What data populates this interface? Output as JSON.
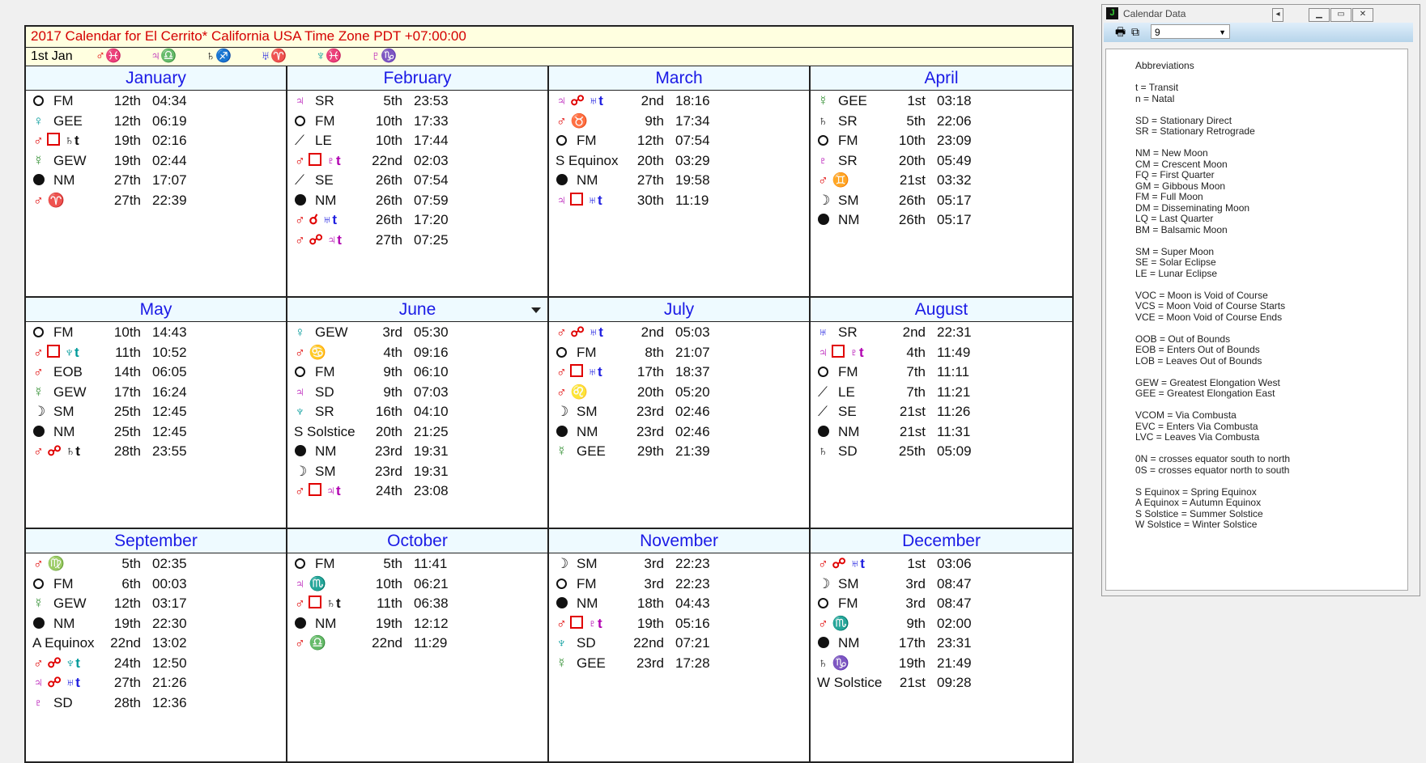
{
  "calendar": {
    "title": "2017 Calendar for El Cerrito* California USA Time Zone PDT +07:00:00",
    "start_label": "1st Jan",
    "positions": [
      {
        "planet": "♂",
        "planet_color": "red",
        "sign": "♓",
        "sign_color": "red"
      },
      {
        "planet": "♃",
        "planet_color": "pur",
        "sign": "♎",
        "sign_color": "blu"
      },
      {
        "planet": "♄",
        "planet_color": "blk",
        "sign": "♐",
        "sign_color": "red"
      },
      {
        "planet": "♅",
        "planet_color": "blu",
        "sign": "♈",
        "sign_color": "red"
      },
      {
        "planet": "♆",
        "planet_color": "tea",
        "sign": "♓",
        "sign_color": "red"
      },
      {
        "planet": "♇",
        "planet_color": "pur",
        "sign": "♑",
        "sign_color": "grn"
      }
    ],
    "months": [
      {
        "name": "January",
        "events": [
          {
            "icon": "fm",
            "label": "FM",
            "day": "12th",
            "time": "04:34"
          },
          {
            "icon": "venus",
            "label": "GEE",
            "day": "12th",
            "time": "06:19"
          },
          {
            "icon": "mars-sq-saturn",
            "day": "19th",
            "time": "02:16"
          },
          {
            "icon": "mercury",
            "label": "GEW",
            "day": "19th",
            "time": "02:44"
          },
          {
            "icon": "nm",
            "label": "NM",
            "day": "27th",
            "time": "17:07"
          },
          {
            "icon": "mars-aries",
            "day": "27th",
            "time": "22:39"
          }
        ]
      },
      {
        "name": "February",
        "events": [
          {
            "icon": "jupiter",
            "label": "SR",
            "day": "5th",
            "time": "23:53"
          },
          {
            "icon": "fm",
            "label": "FM",
            "day": "10th",
            "time": "17:33"
          },
          {
            "icon": "eclipse",
            "label": "LE",
            "day": "10th",
            "time": "17:44"
          },
          {
            "icon": "mars-sq-pluto",
            "day": "22nd",
            "time": "02:03"
          },
          {
            "icon": "eclipse",
            "label": "SE",
            "day": "26th",
            "time": "07:54"
          },
          {
            "icon": "nm",
            "label": "NM",
            "day": "26th",
            "time": "07:59"
          },
          {
            "icon": "mars-conj-uranus",
            "day": "26th",
            "time": "17:20"
          },
          {
            "icon": "mars-opp-jupiter",
            "day": "27th",
            "time": "07:25"
          }
        ]
      },
      {
        "name": "March",
        "events": [
          {
            "icon": "jupiter-opp-uranus",
            "day": "2nd",
            "time": "18:16"
          },
          {
            "icon": "mars-taurus",
            "day": "9th",
            "time": "17:34"
          },
          {
            "icon": "fm",
            "label": "FM",
            "day": "12th",
            "time": "07:54"
          },
          {
            "icon": "text",
            "label": "S Equinox",
            "day": "20th",
            "time": "03:29"
          },
          {
            "icon": "nm",
            "label": "NM",
            "day": "27th",
            "time": "19:58"
          },
          {
            "icon": "jupiter-sq-uranus",
            "day": "30th",
            "time": "11:19"
          }
        ]
      },
      {
        "name": "April",
        "events": [
          {
            "icon": "mercury",
            "label": "GEE",
            "day": "1st",
            "time": "03:18"
          },
          {
            "icon": "saturn",
            "label": "SR",
            "day": "5th",
            "time": "22:06"
          },
          {
            "icon": "fm",
            "label": "FM",
            "day": "10th",
            "time": "23:09"
          },
          {
            "icon": "pluto",
            "label": "SR",
            "day": "20th",
            "time": "05:49"
          },
          {
            "icon": "mars-gemini",
            "day": "21st",
            "time": "03:32"
          },
          {
            "icon": "moon",
            "label": "SM",
            "day": "26th",
            "time": "05:17"
          },
          {
            "icon": "nm",
            "label": "NM",
            "day": "26th",
            "time": "05:17"
          }
        ]
      },
      {
        "name": "May",
        "events": [
          {
            "icon": "fm",
            "label": "FM",
            "day": "10th",
            "time": "14:43"
          },
          {
            "icon": "mars-sq-neptune",
            "day": "11th",
            "time": "10:52"
          },
          {
            "icon": "mars",
            "label": "EOB",
            "day": "14th",
            "time": "06:05"
          },
          {
            "icon": "mercury",
            "label": "GEW",
            "day": "17th",
            "time": "16:24"
          },
          {
            "icon": "moon",
            "label": "SM",
            "day": "25th",
            "time": "12:45"
          },
          {
            "icon": "nm",
            "label": "NM",
            "day": "25th",
            "time": "12:45"
          },
          {
            "icon": "mars-opp-saturn",
            "day": "28th",
            "time": "23:55"
          }
        ]
      },
      {
        "name": "June",
        "dropdown": true,
        "events": [
          {
            "icon": "venus",
            "label": "GEW",
            "day": "3rd",
            "time": "05:30"
          },
          {
            "icon": "mars-cancer",
            "day": "4th",
            "time": "09:16"
          },
          {
            "icon": "fm",
            "label": "FM",
            "day": "9th",
            "time": "06:10"
          },
          {
            "icon": "jupiter",
            "label": "SD",
            "day": "9th",
            "time": "07:03"
          },
          {
            "icon": "neptune",
            "label": "SR",
            "day": "16th",
            "time": "04:10"
          },
          {
            "icon": "text",
            "label": "S Solstice",
            "day": "20th",
            "time": "21:25"
          },
          {
            "icon": "nm",
            "label": "NM",
            "day": "23rd",
            "time": "19:31"
          },
          {
            "icon": "moon",
            "label": "SM",
            "day": "23rd",
            "time": "19:31"
          },
          {
            "icon": "mars-sq-jupiter",
            "day": "24th",
            "time": "23:08"
          }
        ]
      },
      {
        "name": "July",
        "events": [
          {
            "icon": "mars-opp-uranus",
            "day": "2nd",
            "time": "05:03"
          },
          {
            "icon": "fm",
            "label": "FM",
            "day": "8th",
            "time": "21:07"
          },
          {
            "icon": "mars-sq-uranus",
            "day": "17th",
            "time": "18:37"
          },
          {
            "icon": "mars-leo",
            "day": "20th",
            "time": "05:20"
          },
          {
            "icon": "moon",
            "label": "SM",
            "day": "23rd",
            "time": "02:46"
          },
          {
            "icon": "nm",
            "label": "NM",
            "day": "23rd",
            "time": "02:46"
          },
          {
            "icon": "mercury",
            "label": "GEE",
            "day": "29th",
            "time": "21:39"
          }
        ]
      },
      {
        "name": "August",
        "events": [
          {
            "icon": "uranus",
            "label": "SR",
            "day": "2nd",
            "time": "22:31"
          },
          {
            "icon": "jupiter-sq-pluto",
            "day": "4th",
            "time": "11:49"
          },
          {
            "icon": "fm",
            "label": "FM",
            "day": "7th",
            "time": "11:11"
          },
          {
            "icon": "eclipse",
            "label": "LE",
            "day": "7th",
            "time": "11:21"
          },
          {
            "icon": "eclipse",
            "label": "SE",
            "day": "21st",
            "time": "11:26"
          },
          {
            "icon": "nm",
            "label": "NM",
            "day": "21st",
            "time": "11:31"
          },
          {
            "icon": "saturn",
            "label": "SD",
            "day": "25th",
            "time": "05:09"
          }
        ]
      },
      {
        "name": "September",
        "events": [
          {
            "icon": "mars-virgo",
            "day": "5th",
            "time": "02:35"
          },
          {
            "icon": "fm",
            "label": "FM",
            "day": "6th",
            "time": "00:03"
          },
          {
            "icon": "mercury",
            "label": "GEW",
            "day": "12th",
            "time": "03:17"
          },
          {
            "icon": "nm",
            "label": "NM",
            "day": "19th",
            "time": "22:30"
          },
          {
            "icon": "text",
            "label": "A Equinox",
            "day": "22nd",
            "time": "13:02"
          },
          {
            "icon": "mars-opp-neptune",
            "day": "24th",
            "time": "12:50"
          },
          {
            "icon": "jupiter-opp-uranus",
            "day": "27th",
            "time": "21:26"
          },
          {
            "icon": "pluto",
            "label": "SD",
            "day": "28th",
            "time": "12:36"
          }
        ]
      },
      {
        "name": "October",
        "events": [
          {
            "icon": "fm",
            "label": "FM",
            "day": "5th",
            "time": "11:41"
          },
          {
            "icon": "jupiter-scorpio",
            "day": "10th",
            "time": "06:21"
          },
          {
            "icon": "mars-sq-saturn",
            "day": "11th",
            "time": "06:38"
          },
          {
            "icon": "nm",
            "label": "NM",
            "day": "19th",
            "time": "12:12"
          },
          {
            "icon": "mars-libra",
            "day": "22nd",
            "time": "11:29"
          }
        ]
      },
      {
        "name": "November",
        "events": [
          {
            "icon": "moon",
            "label": "SM",
            "day": "3rd",
            "time": "22:23"
          },
          {
            "icon": "fm",
            "label": "FM",
            "day": "3rd",
            "time": "22:23"
          },
          {
            "icon": "nm",
            "label": "NM",
            "day": "18th",
            "time": "04:43"
          },
          {
            "icon": "mars-sq-pluto",
            "day": "19th",
            "time": "05:16"
          },
          {
            "icon": "neptune",
            "label": "SD",
            "day": "22nd",
            "time": "07:21"
          },
          {
            "icon": "mercury",
            "label": "GEE",
            "day": "23rd",
            "time": "17:28"
          }
        ]
      },
      {
        "name": "December",
        "events": [
          {
            "icon": "mars-opp-uranus",
            "day": "1st",
            "time": "03:06"
          },
          {
            "icon": "moon",
            "label": "SM",
            "day": "3rd",
            "time": "08:47"
          },
          {
            "icon": "fm",
            "label": "FM",
            "day": "3rd",
            "time": "08:47"
          },
          {
            "icon": "mars-scorpio",
            "day": "9th",
            "time": "02:00"
          },
          {
            "icon": "nm",
            "label": "NM",
            "day": "17th",
            "time": "23:31"
          },
          {
            "icon": "saturn-capricorn",
            "day": "19th",
            "time": "21:49"
          },
          {
            "icon": "text",
            "label": "W Solstice",
            "day": "21st",
            "time": "09:28"
          }
        ]
      }
    ]
  },
  "side_window": {
    "title": "Calendar Data",
    "app_icon": "J",
    "combo_value": "9",
    "lines": [
      "Abbreviations",
      "",
      "t = Transit",
      "n = Natal",
      "",
      "SD = Stationary Direct",
      "SR = Stationary Retrograde",
      "",
      "NM = New Moon",
      "CM = Crescent Moon",
      "FQ = First Quarter",
      "GM = Gibbous Moon",
      "FM = Full Moon",
      "DM = Disseminating Moon",
      "LQ = Last Quarter",
      "BM = Balsamic Moon",
      "",
      "SM = Super Moon",
      "SE = Solar Eclipse",
      "LE = Lunar Eclipse",
      "",
      "VOC = Moon is Void of Course",
      "VCS = Moon Void of Course Starts",
      "VCE = Moon Void of Course Ends",
      "",
      "OOB = Out of Bounds",
      "EOB = Enters Out of Bounds",
      "LOB = Leaves Out of Bounds",
      "",
      "GEW = Greatest Elongation West",
      "GEE = Greatest Elongation East",
      "",
      "VCOM = Via Combusta",
      "EVC = Enters Via Combusta",
      "LVC = Leaves Via Combusta",
      "",
      "0N = crosses equator south to north",
      "0S = crosses equator north to south",
      "",
      "S Equinox = Spring Equinox",
      "A Equinox = Autumn Equinox",
      "S Solstice = Summer Solstice",
      "W Solstice = Winter Solstice"
    ]
  },
  "colors": {
    "mars": "#e00000",
    "jupiter": "#b000b0",
    "uranus": "#2020e0",
    "neptune": "#009a9a",
    "pluto": "#b000b0",
    "venus": "#009a9a",
    "mercury": "#2a8a2a",
    "header_text": "#1a1ae6",
    "title_text": "#d40000"
  }
}
